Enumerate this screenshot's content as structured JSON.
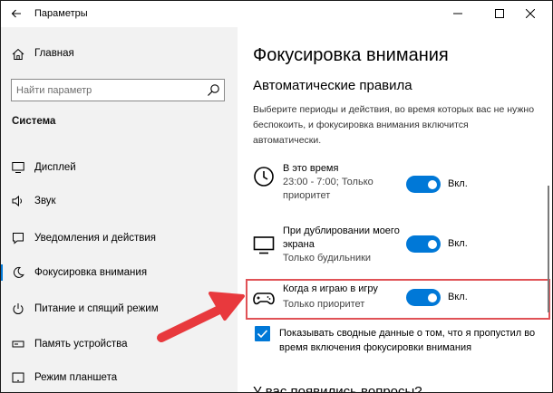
{
  "window": {
    "title": "Параметры",
    "back_icon": "arrow-left-icon",
    "minimize_icon": "minimize-icon",
    "maximize_icon": "maximize-icon",
    "close_icon": "close-icon"
  },
  "sidebar": {
    "home_label": "Главная",
    "search_placeholder": "Найти параметр",
    "section_label": "Система",
    "items": [
      {
        "label": "Дисплей",
        "icon": "monitor-icon",
        "selected": false
      },
      {
        "label": "Звук",
        "icon": "speaker-icon",
        "selected": false
      },
      {
        "label": "Уведомления и действия",
        "icon": "notification-icon",
        "selected": false
      },
      {
        "label": "Фокусировка внимания",
        "icon": "moon-icon",
        "selected": true
      },
      {
        "label": "Питание и спящий режим",
        "icon": "power-icon",
        "selected": false
      },
      {
        "label": "Память устройства",
        "icon": "storage-icon",
        "selected": false
      },
      {
        "label": "Режим планшета",
        "icon": "tablet-icon",
        "selected": false
      }
    ]
  },
  "content": {
    "title": "Фокусировка внимания",
    "subtitle": "Автоматические правила",
    "description": "Выберите периоды и действия, во время которых вас не нужно беспокоить, и фокусировка внимания включится автоматически.",
    "rules": [
      {
        "title": "В это время",
        "subtitle": "23:00 - 7:00; Только приоритет",
        "icon": "clock-icon",
        "toggle_on": true,
        "toggle_label": "Вкл."
      },
      {
        "title": "При дублировании моего экрана",
        "subtitle": "Только будильники",
        "icon": "display-icon",
        "toggle_on": true,
        "toggle_label": "Вкл."
      },
      {
        "title": "Когда я играю в игру",
        "subtitle": "Только приоритет",
        "icon": "gamepad-icon",
        "toggle_on": true,
        "toggle_label": "Вкл."
      }
    ],
    "summary_checkbox": {
      "checked": true,
      "label": "Показывать сводные данные о том, что я пропустил во время включения фокусировки внимания"
    },
    "more_title": "У вас появились вопросы?"
  },
  "colors": {
    "accent": "#0078d7",
    "sidebar_bg": "#f2f2f2",
    "highlight": "#e05256",
    "arrow": "#e8393d"
  }
}
